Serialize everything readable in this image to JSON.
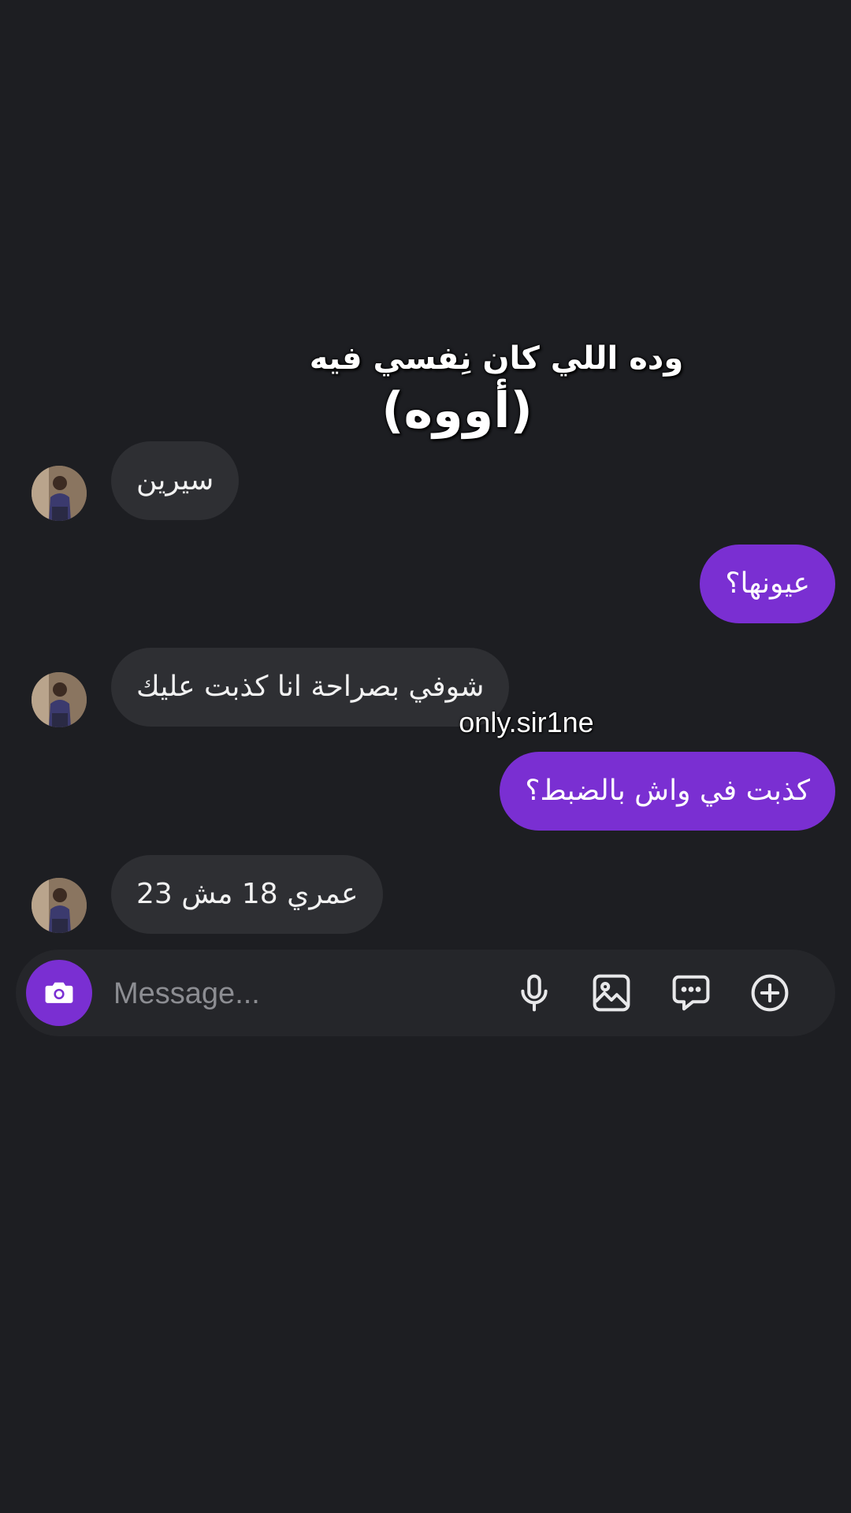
{
  "overlay": {
    "caption_line1": "وده اللي كان نِفسي فيه",
    "caption_line2": "(أووه)",
    "watermark": "only.sir1ne"
  },
  "messages": [
    {
      "side": "incoming",
      "text": "سيرين"
    },
    {
      "side": "outgoing",
      "text": "عيونها؟"
    },
    {
      "side": "incoming",
      "text": "شوفي بصراحة انا كذبت عليك"
    },
    {
      "side": "outgoing",
      "text": "كذبت في واش بالضبط؟"
    },
    {
      "side": "incoming",
      "text": "عمري 18 مش 23"
    }
  ],
  "composer": {
    "placeholder": "Message...",
    "icons": [
      "camera-icon",
      "microphone-icon",
      "image-icon",
      "chat-bubble-icon",
      "plus-circle-icon"
    ]
  },
  "colors": {
    "background": "#1d1e22",
    "incoming_bubble": "#2e2f33",
    "outgoing_bubble": "#7a2fd2",
    "composer": "#25262a"
  }
}
